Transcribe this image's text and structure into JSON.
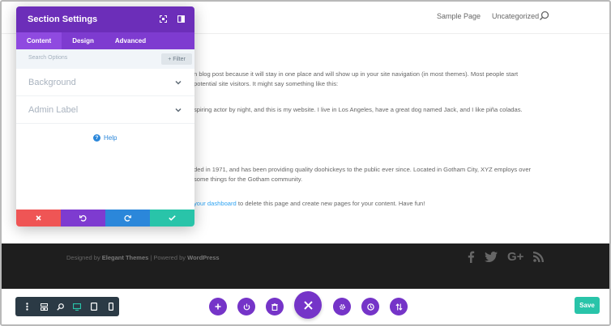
{
  "site": {
    "nav_links": [
      "Sample Page",
      "Uncategorized"
    ],
    "content_lines": [
      "n blog post because it will stay in one place and will show up in your site navigation (in most themes). Most people start",
      "potential site visitors. It might say something like this:",
      "spiring actor by night, and this is my website. I live in Los Angeles, have a great dog named Jack, and I like piña coladas.",
      "ded in 1971, and has been providing quality doohickeys to the public ever since. Located in Gotham City, XYZ employs over",
      "some things for the Gotham community."
    ],
    "last_line_link": "your dashboard",
    "last_line_rest": " to delete this page and create new pages for your content. Have fun!",
    "footer": {
      "prefix": "Designed by ",
      "brand1": "Elegant Themes",
      "separator": " | Powered by ",
      "brand2": "WordPress"
    },
    "social_icons": [
      "facebook-icon",
      "twitter-icon",
      "google-plus-icon",
      "rss-icon"
    ]
  },
  "modal": {
    "title": "Section Settings",
    "tabs": [
      "Content",
      "Design",
      "Advanced"
    ],
    "search_placeholder": "Search Options",
    "filter_label": "+ Filter",
    "options": [
      "Background",
      "Admin Label"
    ],
    "help_label": "Help",
    "footer_colors": {
      "cancel": "#ef5555",
      "undo": "#7e3bd0",
      "redo": "#2b87da",
      "save": "#29c4a9"
    }
  },
  "builder": {
    "save_label": "Save",
    "accent": "#7534c8"
  }
}
